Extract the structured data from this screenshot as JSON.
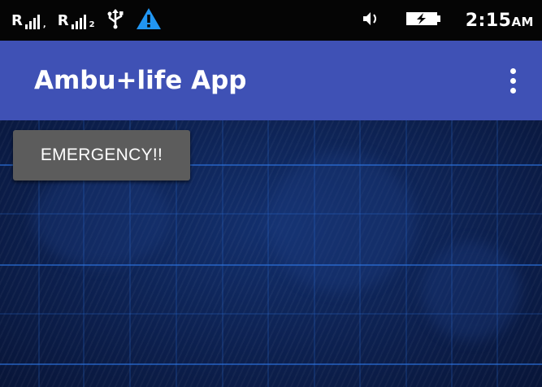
{
  "status_bar": {
    "sim1_label": "R",
    "sim1_sub": ",",
    "sim2_label": "R",
    "sim2_sub": "2",
    "time": "2:15",
    "ampm": "AM",
    "icons": [
      "signal-icon",
      "usb-icon",
      "warning-icon",
      "volume-icon",
      "battery-charging-icon"
    ],
    "warning_color": "#2196F3"
  },
  "app_bar": {
    "title": "Ambu+life App",
    "color": "#3F51B5"
  },
  "content": {
    "emergency_label": "EMERGENCY!!"
  }
}
